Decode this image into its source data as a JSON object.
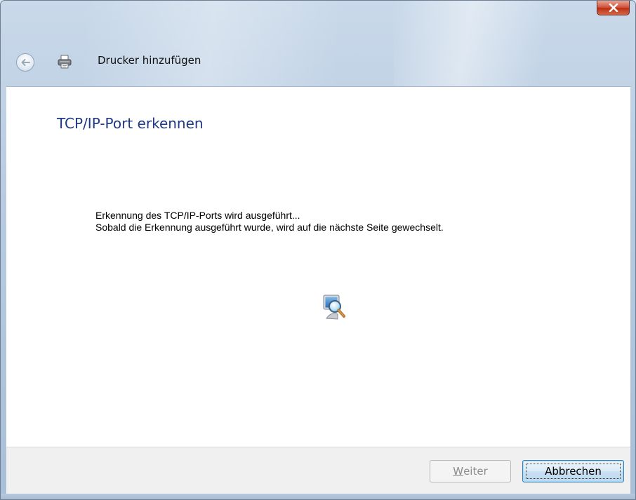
{
  "window": {
    "title": "Drucker hinzufügen"
  },
  "main": {
    "heading": "TCP/IP-Port erkennen",
    "message_line1": "Erkennung des TCP/IP-Ports wird ausgeführt...",
    "message_line2": "Sobald die Erkennung ausgeführt wurde, wird auf die nächste Seite gewechselt.",
    "status_icon": "search-computer-icon"
  },
  "footer": {
    "next_label_accel": "W",
    "next_label_rest": "eiter",
    "next_enabled": false,
    "cancel_label": "Abbrechen"
  },
  "icons": {
    "back": "back-arrow-icon",
    "printer": "printer-icon",
    "close": "close-icon"
  },
  "colors": {
    "heading": "#1e3a87",
    "close_button": "#c8452c"
  }
}
